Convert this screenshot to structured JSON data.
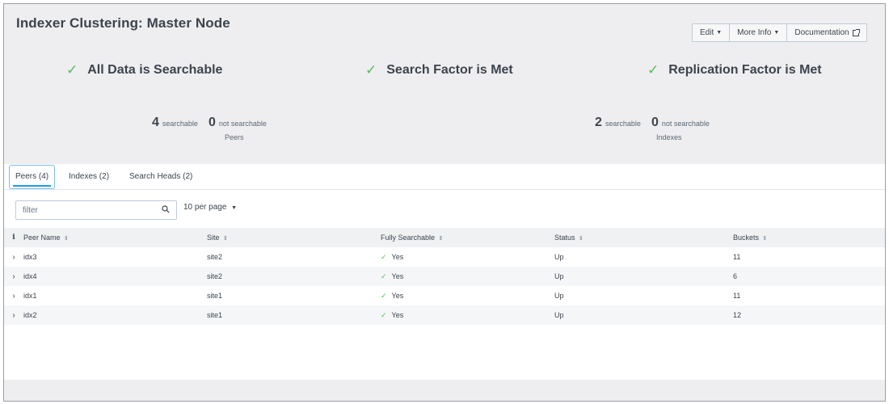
{
  "header": {
    "title": "Indexer Clustering: Master Node",
    "buttons": {
      "edit": "Edit",
      "more_info": "More Info",
      "documentation": "Documentation"
    }
  },
  "status": {
    "all_data": "All Data is Searchable",
    "search_factor": "Search Factor is Met",
    "replication_factor": "Replication Factor is Met"
  },
  "summary": {
    "peers": {
      "searchable_count": "4",
      "searchable_label": "searchable",
      "not_searchable_count": "0",
      "not_searchable_label": "not searchable",
      "caption": "Peers"
    },
    "indexes": {
      "searchable_count": "2",
      "searchable_label": "searchable",
      "not_searchable_count": "0",
      "not_searchable_label": "not searchable",
      "caption": "Indexes"
    }
  },
  "tabs": [
    {
      "label": "Peers (4)",
      "active": true
    },
    {
      "label": "Indexes (2)",
      "active": false
    },
    {
      "label": "Search Heads (2)",
      "active": false
    }
  ],
  "toolbar": {
    "filter_placeholder": "filter",
    "per_page": "10 per page"
  },
  "table": {
    "info_header": "i",
    "columns": [
      "Peer Name",
      "Site",
      "Fully Searchable",
      "Status",
      "Buckets"
    ],
    "rows": [
      {
        "peer": "idx3",
        "site": "site2",
        "searchable": "Yes",
        "status": "Up",
        "buckets": "11"
      },
      {
        "peer": "idx4",
        "site": "site2",
        "searchable": "Yes",
        "status": "Up",
        "buckets": "6"
      },
      {
        "peer": "idx1",
        "site": "site1",
        "searchable": "Yes",
        "status": "Up",
        "buckets": "11"
      },
      {
        "peer": "idx2",
        "site": "site1",
        "searchable": "Yes",
        "status": "Up",
        "buckets": "12"
      }
    ]
  },
  "colors": {
    "check_green": "#5cb85c",
    "tab_accent": "#1a9fe0",
    "text": "#3c444d"
  },
  "icons": {
    "check": "check-icon",
    "search": "search-icon",
    "caret": "caret-down-icon",
    "external": "external-link-icon",
    "expand": "chevron-right-icon"
  }
}
